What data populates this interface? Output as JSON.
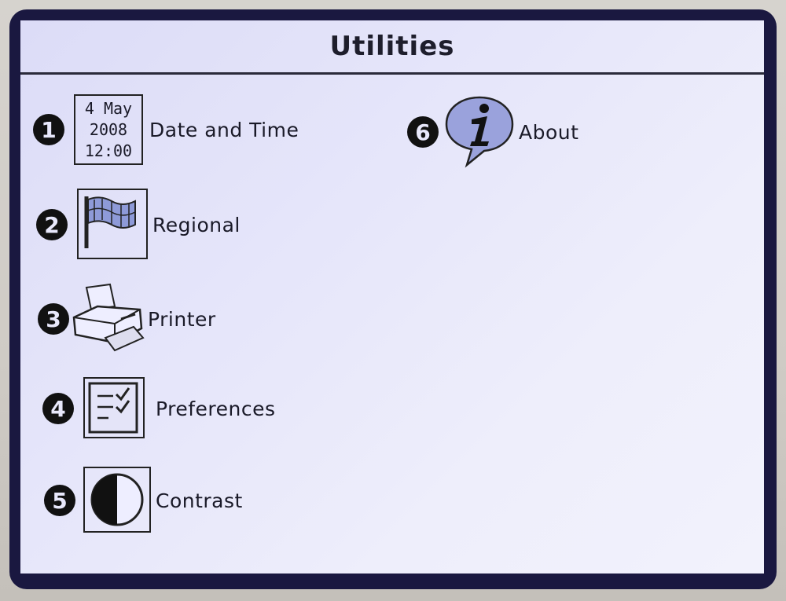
{
  "screen": {
    "title": "Utilities"
  },
  "menu": {
    "items": [
      {
        "number": "1",
        "label": "Date and Time",
        "icon": "calendar-icon",
        "calendar": {
          "day_month": "4 May",
          "year": "2008",
          "time": "12:00"
        }
      },
      {
        "number": "2",
        "label": "Regional",
        "icon": "flag-icon"
      },
      {
        "number": "3",
        "label": "Printer",
        "icon": "printer-icon"
      },
      {
        "number": "4",
        "label": "Preferences",
        "icon": "checklist-icon"
      },
      {
        "number": "5",
        "label": "Contrast",
        "icon": "contrast-icon"
      },
      {
        "number": "6",
        "label": "About",
        "icon": "info-bubble-icon"
      }
    ]
  },
  "colors": {
    "screen_bg": "#e6e6fa",
    "frame": "#1a1840",
    "text": "#1a1a28"
  }
}
